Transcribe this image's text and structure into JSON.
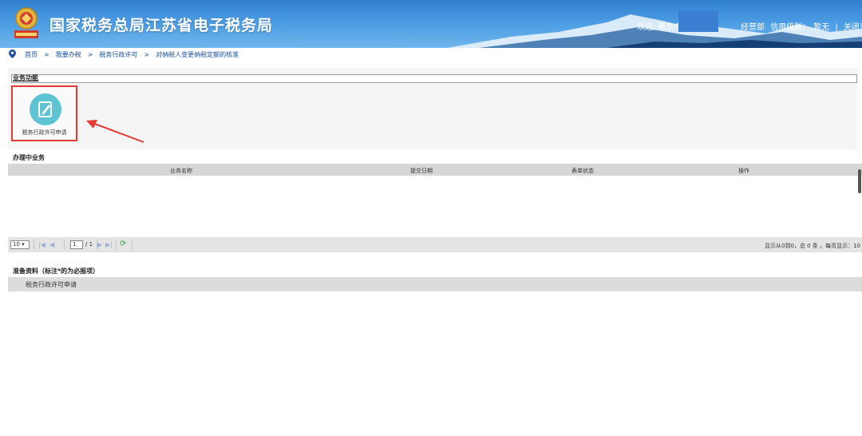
{
  "header": {
    "title": "国家税务总局江苏省电子税务局",
    "welcome": "欢迎, 南京市",
    "right_text": "经营部",
    "credit_label": "信用级别：",
    "credit_value": "暂无",
    "separator": "|",
    "close_label": "关闭当页",
    "emblem_icon": "tax-emblem-icon",
    "colors": {
      "banner": "#2f7fcf",
      "mask": "#3b7fd2"
    }
  },
  "breadcrumb": {
    "icon": "location-pin-icon",
    "items": [
      "首页",
      "我要办税",
      "税务行政许可",
      "对纳税人变更纳税定额的核准"
    ],
    "separator": ">"
  },
  "business_functions": {
    "title": "业务功能",
    "tiles": [
      {
        "label": "税务行政许可申请",
        "icon": "edit-document-icon"
      }
    ],
    "highlight_color": "#e53935"
  },
  "in_progress": {
    "title": "办理中业务",
    "columns": [
      "业务名称",
      "提交日期",
      "表单状态",
      "操作"
    ],
    "rows": []
  },
  "pager": {
    "page_size": "10",
    "current_page": "1",
    "total_pages": "/ 1",
    "info": "显示从0到0，总 0 条 。每页显示：10"
  },
  "prep_materials": {
    "title": "准备资料（标注*的为必报项）",
    "items": [
      "税务行政许可申请"
    ]
  }
}
